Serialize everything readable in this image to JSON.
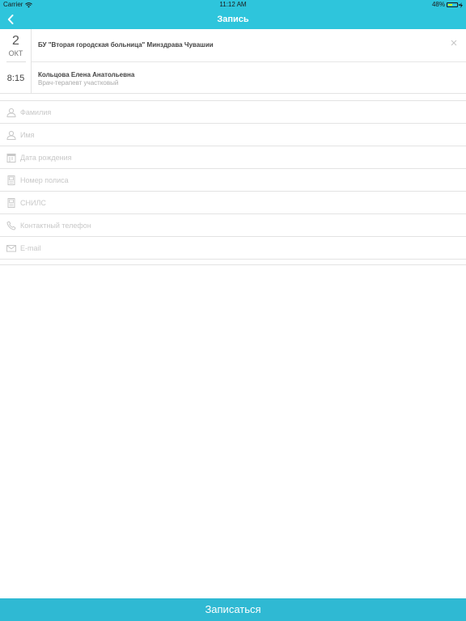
{
  "status_bar": {
    "carrier": "Carrier",
    "time": "11:12 AM",
    "battery": "48%"
  },
  "nav": {
    "title": "Запись"
  },
  "appointment": {
    "day": "2",
    "month": "ОКТ",
    "time": "8:15",
    "clinic": "БУ \"Вторая городская больница\" Минздрава Чувашии",
    "doctor": "Кольцова Елена Анатольевна",
    "specialty": "Врач-терапевт участковый"
  },
  "form": {
    "fields": [
      {
        "placeholder": "Фамилия",
        "icon": "person-icon"
      },
      {
        "placeholder": "Имя",
        "icon": "person-icon"
      },
      {
        "placeholder": "Дата рождения",
        "icon": "calendar-icon"
      },
      {
        "placeholder": "Номер полиса",
        "icon": "document-icon"
      },
      {
        "placeholder": "СНИЛС",
        "icon": "document-icon"
      },
      {
        "placeholder": "Контактный телефон",
        "icon": "phone-icon"
      },
      {
        "placeholder": "E-mail",
        "icon": "envelope-icon"
      }
    ]
  },
  "submit_label": "Записаться",
  "colors": {
    "accent": "#2ec5dc",
    "button": "#2fb9d3",
    "placeholder": "#c8c8c8",
    "divider": "#e3e3e3"
  }
}
